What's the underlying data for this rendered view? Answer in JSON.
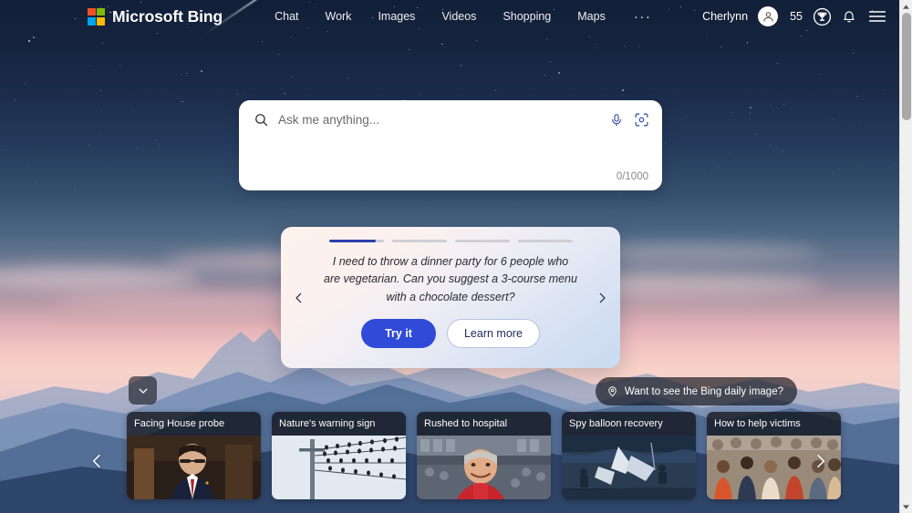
{
  "header": {
    "brand": "Microsoft Bing",
    "logo_icon": "microsoft-logo-icon",
    "logo_colors": [
      "#f25022",
      "#7fba00",
      "#00a4ef",
      "#ffb900"
    ],
    "nav": [
      {
        "label": "Chat"
      },
      {
        "label": "Work"
      },
      {
        "label": "Images"
      },
      {
        "label": "Videos"
      },
      {
        "label": "Shopping"
      },
      {
        "label": "Maps"
      }
    ],
    "more_label": "···",
    "user_name": "Cherlynn",
    "avatar_icon": "user-avatar-icon",
    "points": "55",
    "rewards_icon": "trophy-rewards-icon",
    "notifications_icon": "bell-icon",
    "menu_icon": "hamburger-menu-icon"
  },
  "search": {
    "search_icon": "search-icon",
    "placeholder": "Ask me anything...",
    "value": "",
    "mic_icon": "microphone-icon",
    "visual_search_icon": "visual-search-camera-icon",
    "char_count": "0/1000"
  },
  "suggestion_card": {
    "progress": [
      {
        "fill_percent": 85,
        "active": true
      },
      {
        "fill_percent": 0,
        "active": false
      },
      {
        "fill_percent": 0,
        "active": false
      },
      {
        "fill_percent": 0,
        "active": false
      }
    ],
    "text": "I need to throw a dinner party for 6 people who are vegetarian. Can you suggest a 3-course menu with a chocolate dessert?",
    "try_label": "Try it",
    "learn_label": "Learn more",
    "prev_icon": "chevron-left-icon",
    "next_icon": "chevron-right-icon",
    "accent_color": "#2f4bd8"
  },
  "bottom_bar": {
    "collapse_icon": "chevron-down-icon",
    "daily_image_icon": "location-pin-icon",
    "daily_image_label": "Want to see the Bing daily image?"
  },
  "news": {
    "prev_icon": "chevron-left-icon",
    "next_icon": "chevron-right-icon",
    "cards": [
      {
        "headline": "Facing House probe",
        "theme": "courtroom"
      },
      {
        "headline": "Nature's warning sign",
        "theme": "birds-on-wire"
      },
      {
        "headline": "Rushed to hospital",
        "theme": "stadium-man"
      },
      {
        "headline": "Spy balloon recovery",
        "theme": "ocean-recovery"
      },
      {
        "headline": "How to help victims",
        "theme": "crowd-aid"
      }
    ]
  },
  "scrollbar": {
    "up_icon": "scroll-up-arrow-icon",
    "down_icon": "scroll-down-arrow-icon",
    "thumb": "scrollbar-thumb"
  }
}
